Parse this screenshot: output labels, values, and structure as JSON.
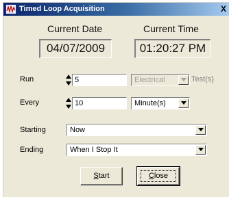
{
  "window": {
    "title": "Timed Loop Acquisition",
    "close_glyph": "X"
  },
  "date": {
    "label": "Current Date",
    "value": "04/07/2009"
  },
  "time": {
    "label": "Current Time",
    "value": "01:20:27 PM"
  },
  "run": {
    "label": "Run",
    "count": "5",
    "mode": "Electrical",
    "mode_enabled": false,
    "suffix": "Test(s)"
  },
  "every": {
    "label": "Every",
    "count": "10",
    "unit": "Minute(s)"
  },
  "starting": {
    "label": "Starting",
    "value": "Now"
  },
  "ending": {
    "label": "Ending",
    "value": "When I Stop It"
  },
  "buttons": {
    "start": {
      "mnemonic": "S",
      "rest": "tart"
    },
    "close": {
      "mnemonic": "C",
      "rest": "lose"
    }
  },
  "icons": {
    "title": "waveform-icon",
    "spin": "spin-updown-icon",
    "dropdown": "chevron-down-icon"
  }
}
